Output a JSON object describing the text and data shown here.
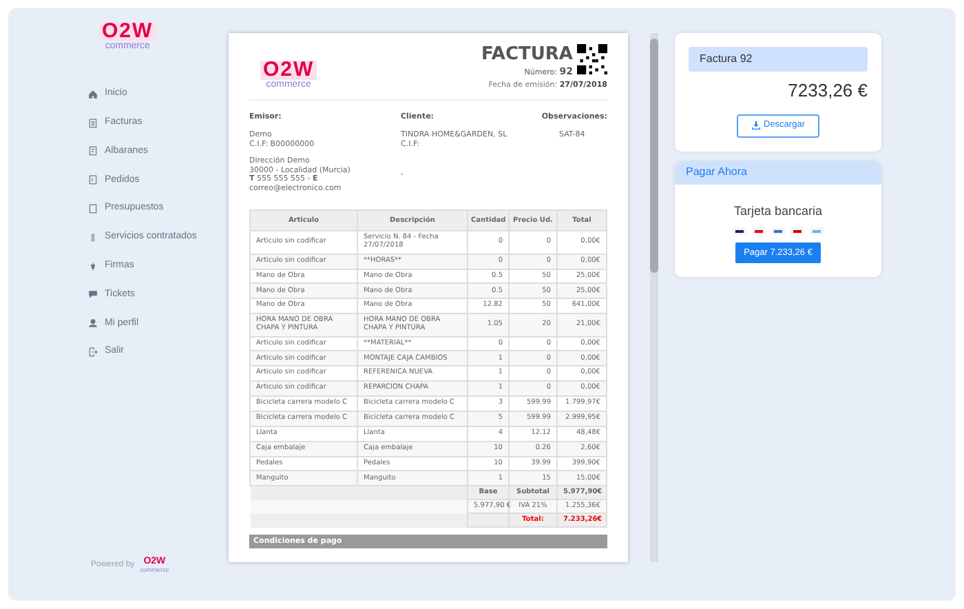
{
  "sidebar": {
    "logo": {
      "mark": "O2W",
      "sub": "commerce"
    },
    "items": [
      {
        "label": "Inicio"
      },
      {
        "label": "Facturas"
      },
      {
        "label": "Albaranes"
      },
      {
        "label": "Pedidos"
      },
      {
        "label": "Presupuestos"
      },
      {
        "label": "Servicios contratados"
      },
      {
        "label": "Firmas"
      },
      {
        "label": "Tickets"
      },
      {
        "label": "Mi perfil"
      },
      {
        "label": "Salir"
      }
    ],
    "footer": {
      "label": "Powered by",
      "mark": "O2W",
      "sub": "commerce"
    }
  },
  "invoice": {
    "logo": {
      "mark": "O2W",
      "sub": "commerce"
    },
    "title": "FACTURA",
    "number_label": "Número:",
    "number": "92",
    "date_label": "Fecha de emisión:",
    "date": "27/07/2018",
    "parties": [
      {
        "heading": "Emisor:",
        "blocks": [
          [
            "Demo",
            "C.I.F: B00000000"
          ],
          [
            "Dirección Demo",
            "30000 - Localidad (Murcia)",
            "**T** 555 555 555 - **E**",
            "correo@electronico.com"
          ]
        ]
      },
      {
        "heading": "Cliente:",
        "blocks": [
          [
            "TINDRA HOME&GARDEN, SL",
            "C.I.F:"
          ],
          [
            "-"
          ]
        ]
      },
      {
        "heading": "Observaciones:",
        "blocks": [
          [
            "SAT-84"
          ]
        ]
      }
    ],
    "columns": [
      "Articulo",
      "Descripción",
      "Cantidad",
      "Precio Ud.",
      "Total"
    ],
    "rows": [
      [
        "Articulo sin codificar",
        "Servicio N. 84 - Fecha 27/07/2018",
        "0",
        "0",
        "0,00€"
      ],
      [
        "Articulo sin codificar",
        "**HORAS**",
        "0",
        "0",
        "0,00€"
      ],
      [
        "Mano de Obra",
        "Mano de Obra",
        "0.5",
        "50",
        "25,00€"
      ],
      [
        "Mano de Obra",
        "Mano de Obra",
        "0.5",
        "50",
        "25,00€"
      ],
      [
        "Mano de Obra",
        "Mano de Obra",
        "12.82",
        "50",
        "641,00€"
      ],
      [
        "HORA MANO DE OBRA CHAPA Y PINTURA",
        "HORA MANO DE OBRA CHAPA Y PINTURA",
        "1.05",
        "20",
        "21,00€"
      ],
      [
        "Articulo sin codificar",
        "**MATERIAL**",
        "0",
        "0",
        "0,00€"
      ],
      [
        "Articulo sin codificar",
        "MONTAJE CAJA CAMBIOS",
        "1",
        "0",
        "0,00€"
      ],
      [
        "Articulo sin codificar",
        "REFERENICA NUEVA",
        "1",
        "0",
        "0,00€"
      ],
      [
        "Articulo sin codificar",
        "REPARCION CHAPA",
        "1",
        "0",
        "0,00€"
      ],
      [
        "Bicicleta carrera modelo C",
        "Bicicleta carrera modelo C",
        "3",
        "599.99",
        "1.799,97€"
      ],
      [
        "Bicicleta carrera modelo C",
        "Bicicleta carrera modelo C",
        "5",
        "599.99",
        "2.999,95€"
      ],
      [
        "Llanta",
        "Llanta",
        "4",
        "12.12",
        "48,48€"
      ],
      [
        "Caja embalaje",
        "Caja embalaje",
        "10",
        "0.26",
        "2,60€"
      ],
      [
        "Pedales",
        "Pedales",
        "10",
        "39.99",
        "399,90€"
      ],
      [
        "Manguito",
        "Manguito",
        "1",
        "15",
        "15,00€"
      ]
    ],
    "totals": {
      "base_label": "Base",
      "subtotal_label": "Subtotal",
      "subtotal": "5.977,90€",
      "base": "5.977,90 €",
      "tax_label": "IVA 21%",
      "tax": "1.255,36€",
      "total_label": "Total:",
      "total": "7.233,26€"
    },
    "payment_terms": "Condiciones de pago"
  },
  "summary": {
    "title": "Factura 92",
    "amount": "7233,26 €",
    "download": "Descargar"
  },
  "pay": {
    "title": "Pagar Ahora",
    "method": "Tarjeta bancaria",
    "button": "Pagar 7.233,26 €"
  }
}
